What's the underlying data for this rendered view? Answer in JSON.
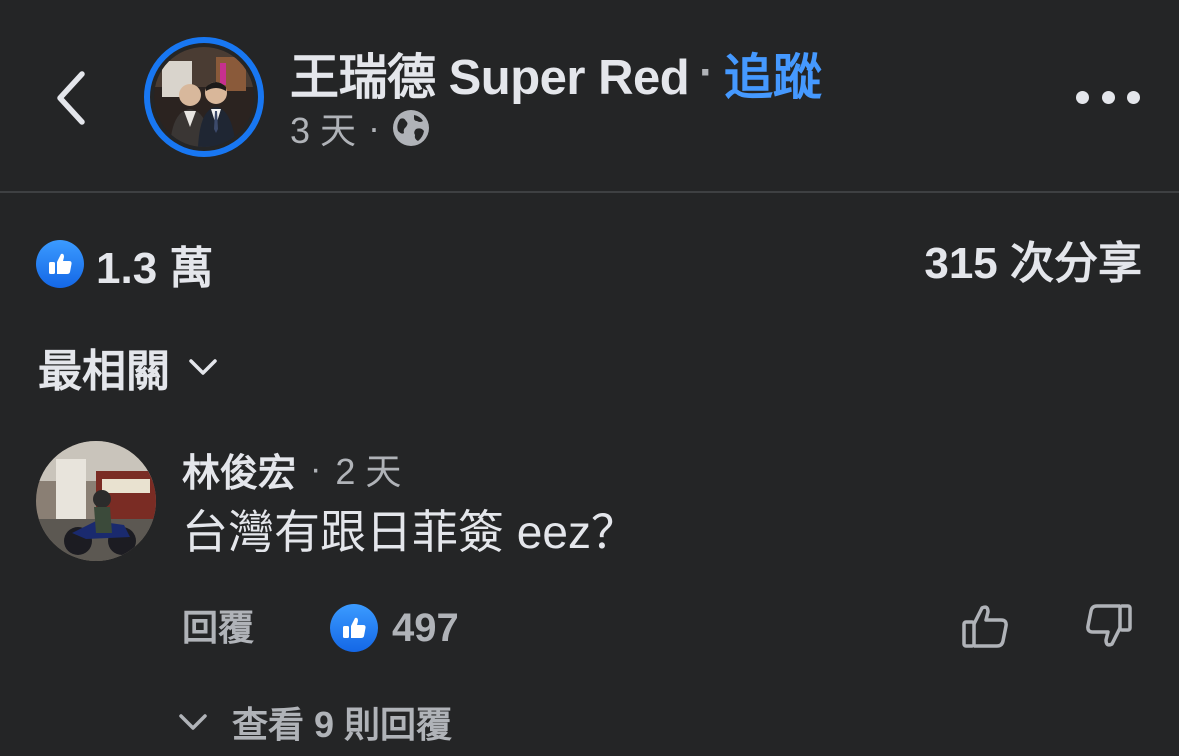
{
  "header": {
    "page_name": "王瑞德 Super Red",
    "separator": "·",
    "follow_label": "追蹤",
    "time": "3 天",
    "meta_separator": "·",
    "privacy_icon": "globe-icon",
    "more_icon": "more-options-icon",
    "back_icon": "back-chevron-icon"
  },
  "stats": {
    "like_icon": "like-thumb-icon",
    "likes": "1.3 萬",
    "shares": "315 次分享"
  },
  "sort": {
    "label": "最相關",
    "icon": "chevron-down-icon"
  },
  "comment": {
    "author": "林俊宏",
    "separator": "·",
    "time": "2 天",
    "text": "台灣有跟日菲簽 eez？",
    "reply_label": "回覆",
    "like_count": "497",
    "upvote_icon": "thumbs-up-outline-icon",
    "downvote_icon": "thumbs-down-outline-icon"
  },
  "view_replies": {
    "label": "查看 9 則回覆",
    "icon": "chevron-down-icon"
  },
  "colors": {
    "background": "#242526",
    "primary_text": "#e4e6eb",
    "secondary_text": "#b0b3b8",
    "accent": "#1877f2",
    "link": "#4599ff"
  }
}
